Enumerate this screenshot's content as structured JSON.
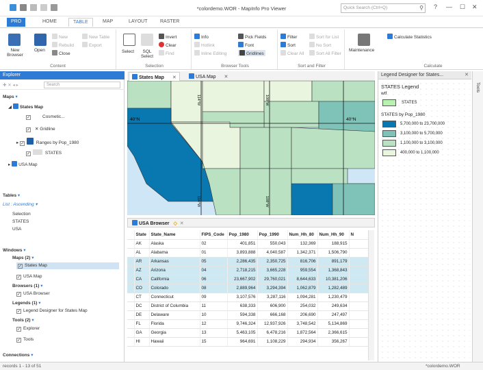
{
  "window": {
    "title": "*colordemo.WOR - MapInfo Pro Viewer",
    "search_placeholder": "Quick Search (Ctrl+Q)",
    "help": "?",
    "minimize": "—",
    "maximize": "☐",
    "close": "✕"
  },
  "tabs": [
    "PRO",
    "HOME",
    "TABLE",
    "MAP",
    "LAYOUT",
    "RASTER"
  ],
  "ribbon": {
    "content": {
      "label": "Content",
      "new_browser": "New Browser",
      "open": "Open",
      "new": "New",
      "rebuild": "Rebuild",
      "close": "Close",
      "new_table": "New Table",
      "export": "Export"
    },
    "selection": {
      "label": "Selection",
      "select": "Select",
      "sql_select": "SQL Select",
      "invert": "Invert",
      "clear": "Clear",
      "find": "Find"
    },
    "browser_tools": {
      "label": "Browser Tools",
      "info": "Info",
      "hotlink": "Hotlink",
      "inline_editing": "Inline Editing",
      "pick_fields": "Pick Fields",
      "font": "Font",
      "gridlines": "Gridlines"
    },
    "sort_filter": {
      "label": "Sort and Filter",
      "filter": "Filter",
      "sort": "Sort",
      "sort_clear": "Sort for List",
      "clear_all": "Clear All",
      "no_sort": "No Sort",
      "sort_all_filter": "Sort All Filter"
    },
    "maintenance": {
      "label": "Maintenance"
    },
    "calculate": {
      "label": "Calculate",
      "stats": "Calculate Statistics"
    }
  },
  "explorer": {
    "title": "Explorer",
    "search_placeholder": "Search",
    "maps_label": "Maps",
    "maps": [
      {
        "label": "States Map",
        "bold": true
      },
      {
        "label": "Cosmetic..."
      },
      {
        "label": "Gridline"
      },
      {
        "label": "Ranges by Pop_1980"
      },
      {
        "label": "STATES"
      },
      {
        "label": "USA Map"
      }
    ],
    "tables_label": "Tables",
    "tables_sort": "List : Ascending",
    "tables": [
      "Selection",
      "STATES",
      "USA"
    ],
    "windows_label": "Windows",
    "win_groups": {
      "maps": "Maps (2)",
      "browsers": "Browsers (1)",
      "legends": "Legends (1)",
      "tools": "Tools (2)"
    },
    "win_items": {
      "states_map": "States Map",
      "usa_map": "USA Map",
      "usa_browser": "USA Browser",
      "legend_designer": "Legend Designer for States Map",
      "explorer": "Explorer",
      "tools": "Tools"
    },
    "connections_label": "Connections"
  },
  "doc_tabs": [
    "States Map",
    "USA Map"
  ],
  "map": {
    "lat_label_left": "40°N",
    "lat_label_right": "40°N",
    "meridian_labels": [
      "114°W",
      "108°W",
      "114°W",
      "108°W"
    ]
  },
  "browser": {
    "title": "USA Browser",
    "columns": [
      "State",
      "State_Name",
      "FIPS_Code",
      "Pop_1980",
      "Pop_1990",
      "Num_Hh_80",
      "Num_Hh_90",
      "N"
    ],
    "rows": [
      [
        "AK",
        "Alaska",
        "02",
        "401,851",
        "550,043",
        "132,369",
        "188,915",
        false
      ],
      [
        "AL",
        "Alabama",
        "01",
        "3,893,888",
        "4,040,587",
        "1,342,371",
        "1,506,790",
        false
      ],
      [
        "AR",
        "Arkansas",
        "05",
        "2,286,435",
        "2,350,725",
        "816,706",
        "891,179",
        true
      ],
      [
        "AZ",
        "Arizona",
        "04",
        "2,718,215",
        "3,665,228",
        "959,554",
        "1,368,843",
        true
      ],
      [
        "CA",
        "California",
        "06",
        "23,667,902",
        "29,760,021",
        "8,644,633",
        "10,381,206",
        true
      ],
      [
        "CO",
        "Colorado",
        "08",
        "2,889,964",
        "3,294,394",
        "1,062,879",
        "1,282,489",
        true
      ],
      [
        "CT",
        "Connecticut",
        "09",
        "3,107,576",
        "3,287,116",
        "1,094,281",
        "1,230,479",
        false
      ],
      [
        "DC",
        "District of Columbia",
        "11",
        "638,333",
        "606,900",
        "254,032",
        "249,634",
        false
      ],
      [
        "DE",
        "Delaware",
        "10",
        "594,338",
        "666,168",
        "206,690",
        "247,497",
        false
      ],
      [
        "FL",
        "Florida",
        "12",
        "9,746,324",
        "12,937,926",
        "3,748,542",
        "5,134,869",
        false
      ],
      [
        "GA",
        "Georgia",
        "13",
        "5,463,105",
        "6,478,216",
        "1,872,564",
        "2,366,615",
        false
      ],
      [
        "HI",
        "Hawaii",
        "15",
        "964,691",
        "1,108,229",
        "294,934",
        "356,267",
        false
      ]
    ]
  },
  "legend": {
    "panel_title": "Legend Designer for States...",
    "title": "STATES Legend",
    "subtitle": "wtf",
    "frame1_label": "STATES",
    "frame2_title": "STATES by Pop_1980",
    "ranges": [
      {
        "label": "5,700,000  to  23,700,000",
        "color": "#0a78b0"
      },
      {
        "label": "3,100,000  to    5,700,000",
        "color": "#7fc3b8"
      },
      {
        "label": "1,100,000  to    3,100,000",
        "color": "#b9e1c2"
      },
      {
        "label": "400,000  to    1,100,000",
        "color": "#eaf5df"
      }
    ],
    "states_color": "#b8f2b0"
  },
  "tools_label": "Tools",
  "status": {
    "records": "records 1 - 13 of 51",
    "workspace": "*colordemo.WOR"
  }
}
